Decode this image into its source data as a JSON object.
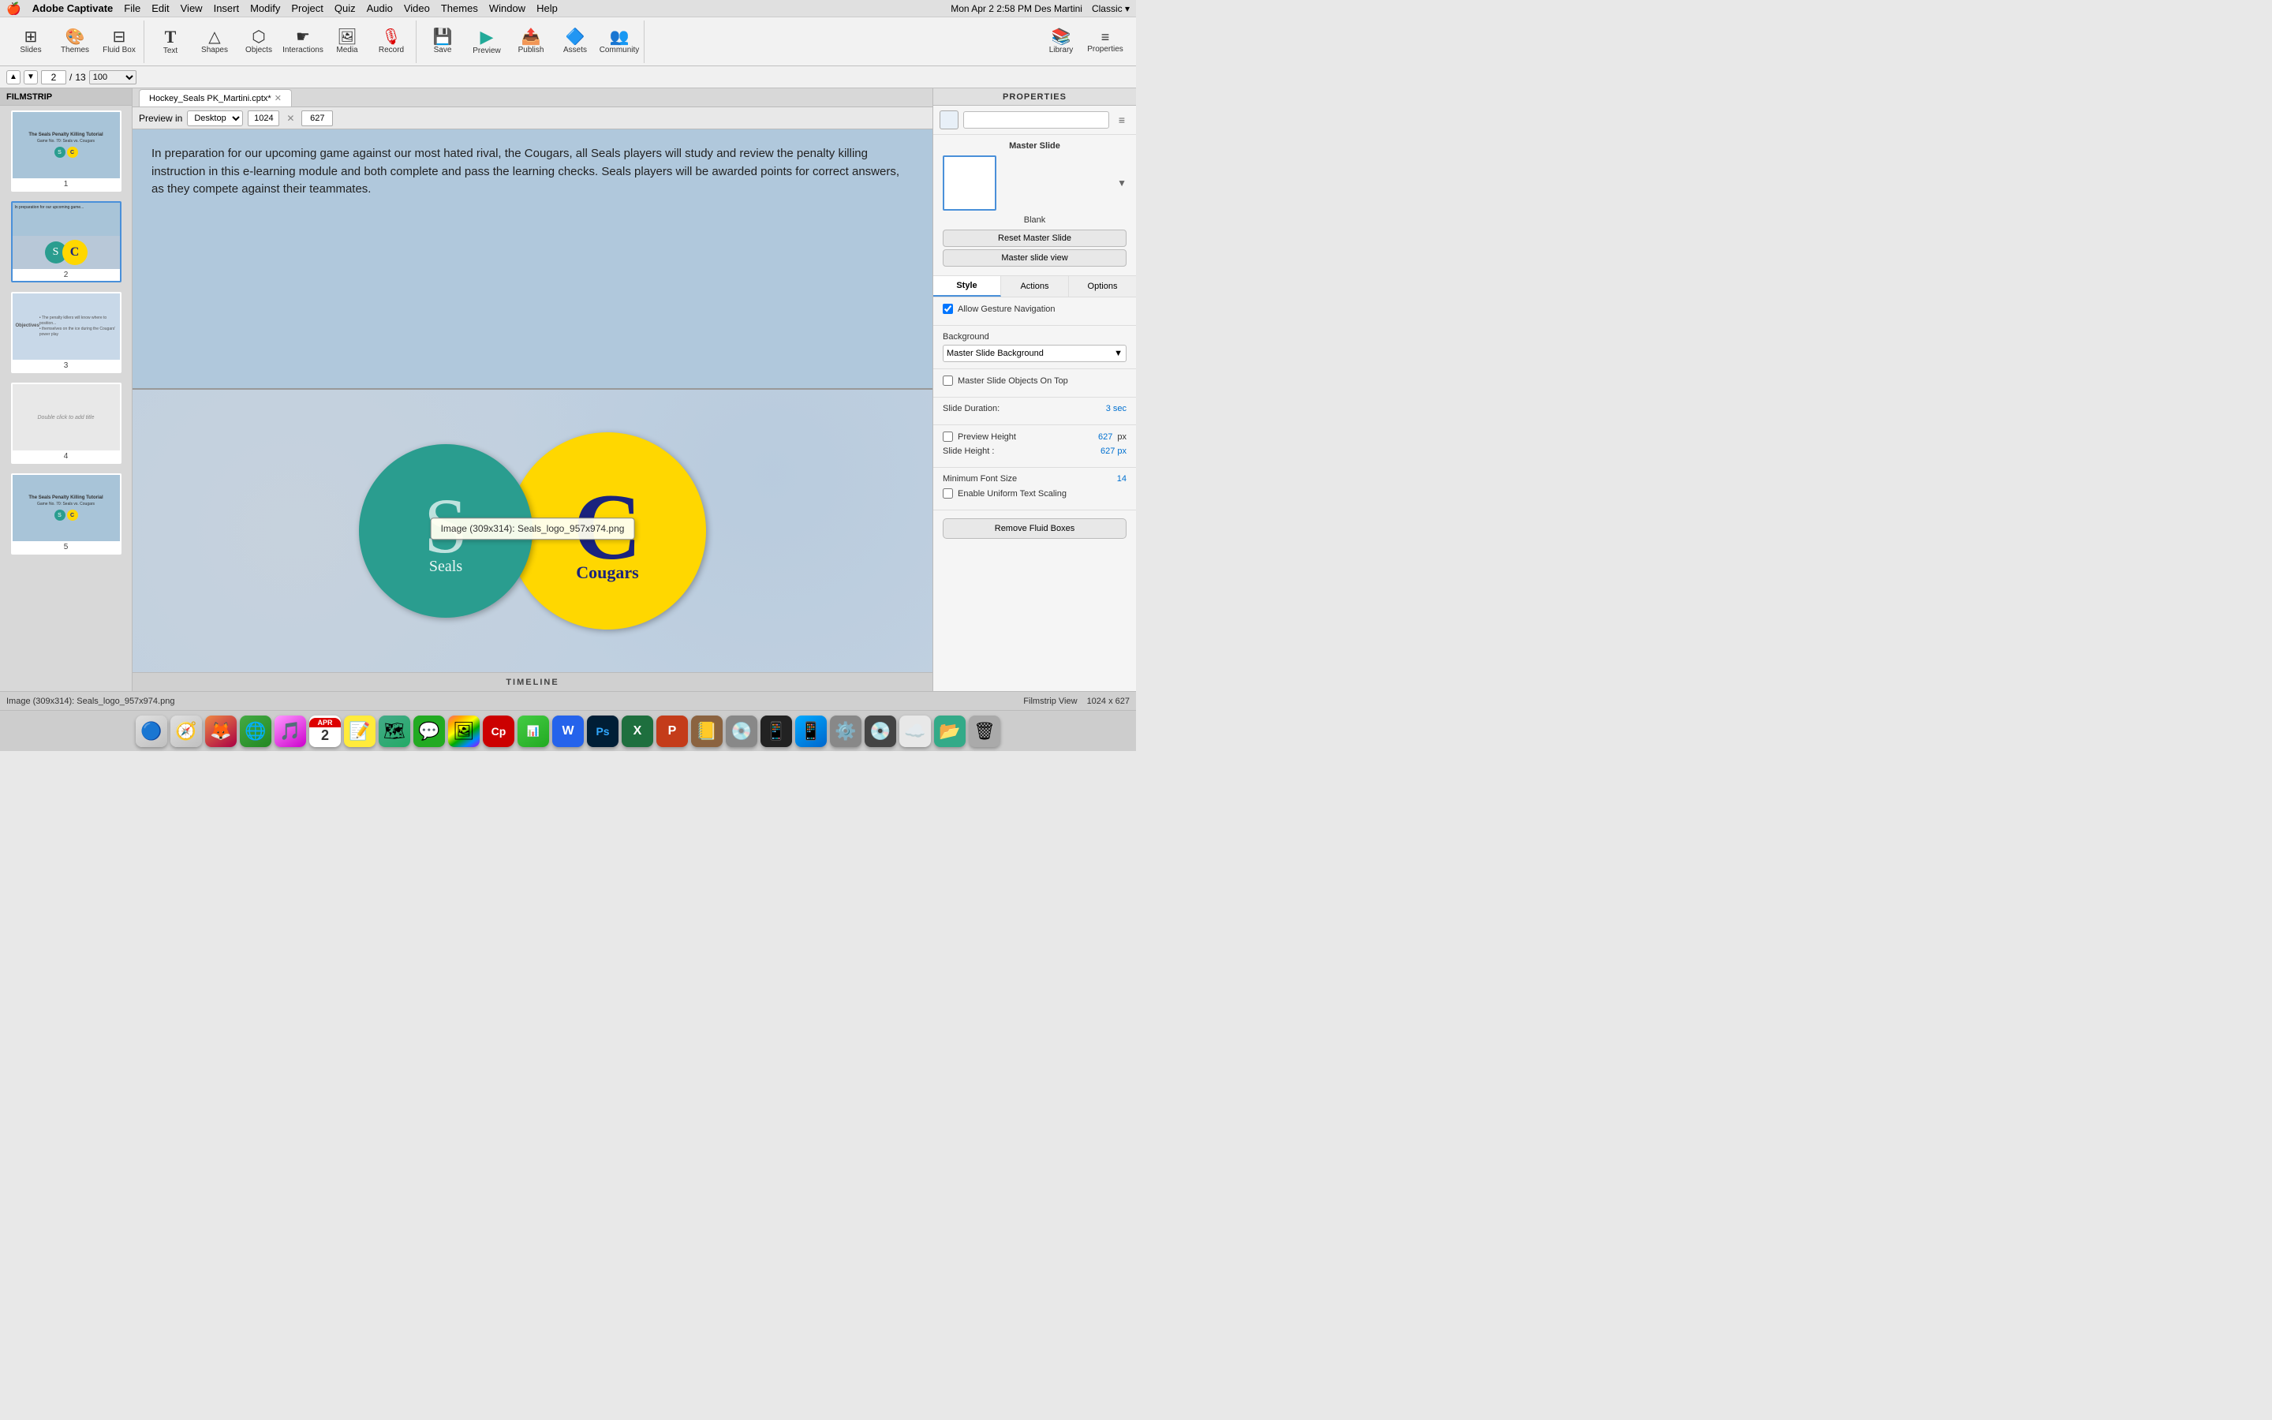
{
  "menubar": {
    "apple": "🍎",
    "app_name": "Adobe Captivate",
    "menus": [
      "File",
      "Edit",
      "View",
      "Insert",
      "Modify",
      "Project",
      "Quiz",
      "Audio",
      "Video",
      "Themes",
      "Window",
      "Help"
    ],
    "right_info": "Mon Apr 2  2:58 PM  Des Martini",
    "classic_label": "Classic ▾"
  },
  "toolbar": {
    "buttons": [
      {
        "id": "slides",
        "icon": "⊞",
        "label": "Slides"
      },
      {
        "id": "themes",
        "icon": "🎨",
        "label": "Themes"
      },
      {
        "id": "fluidbox",
        "icon": "⊟",
        "label": "Fluid Box"
      },
      {
        "id": "text",
        "icon": "T",
        "label": "Text"
      },
      {
        "id": "shapes",
        "icon": "△",
        "label": "Shapes"
      },
      {
        "id": "objects",
        "icon": "⬡",
        "label": "Objects"
      },
      {
        "id": "interactions",
        "icon": "☛",
        "label": "Interactions"
      },
      {
        "id": "media",
        "icon": "🖼",
        "label": "Media"
      },
      {
        "id": "record",
        "icon": "🎙",
        "label": "Record"
      },
      {
        "id": "save",
        "icon": "💾",
        "label": "Save"
      },
      {
        "id": "preview",
        "icon": "▷",
        "label": "Preview"
      },
      {
        "id": "publish",
        "icon": "📤",
        "label": "Publish"
      },
      {
        "id": "assets",
        "icon": "🔷",
        "label": "Assets"
      },
      {
        "id": "community",
        "icon": "👥",
        "label": "Community"
      }
    ],
    "right_buttons": [
      {
        "id": "library",
        "icon": "📚",
        "label": "Library"
      },
      {
        "id": "properties",
        "icon": "≡",
        "label": "Properties"
      }
    ]
  },
  "nav_bar": {
    "current_page": "2",
    "total_pages": "13",
    "zoom": "100"
  },
  "filmstrip": {
    "header": "FILMSTRIP",
    "slides": [
      {
        "number": "1",
        "content": "title_slide"
      },
      {
        "number": "2",
        "content": "logo_slide",
        "active": true
      },
      {
        "number": "3",
        "content": "objectives_slide"
      },
      {
        "number": "4",
        "content": "blank_slide"
      },
      {
        "number": "5",
        "content": "title_slide2"
      }
    ]
  },
  "canvas": {
    "tab_name": "Hockey_Seals PK_Martini.cptx*",
    "preview_in": "Preview in",
    "preview_mode": "Desktop",
    "width": "1024",
    "height": "627",
    "slide_text": "In preparation for our upcoming game against our most hated rival, the Cougars, all Seals players will study  and review the penalty killing instruction in this e-learning module and both complete and pass the learning checks. Seals players will be awarded points for correct answers, as they compete against their teammates.",
    "tooltip": "Image (309x314): Seals_logo_957x974.png",
    "seals_letter": "S",
    "seals_label": "Seals",
    "cougars_letter": "C",
    "cougars_label": "Cougars",
    "timeline_label": "TIMELINE"
  },
  "properties": {
    "header": "PROPERTIES",
    "master_slide_label": "Master Slide",
    "blank_label": "Blank",
    "reset_btn": "Reset Master Slide",
    "master_view_btn": "Master slide view",
    "tabs": [
      "Style",
      "Actions",
      "Options"
    ],
    "active_tab": "Style",
    "allow_gesture": "Allow Gesture Navigation",
    "background_label": "Background",
    "background_value": "Master Slide Background",
    "master_objects_top": "Master Slide Objects On Top",
    "slide_duration_label": "Slide Duration:",
    "slide_duration_value": "3 sec",
    "preview_height_label": "Preview Height",
    "preview_height_value": "627",
    "preview_height_unit": "px",
    "slide_height_label": "Slide Height :",
    "slide_height_value": "627 px",
    "min_font_size_label": "Minimum Font Size",
    "min_font_size_value": "14",
    "uniform_text_label": "Enable Uniform Text Scaling",
    "remove_fluid_btn": "Remove Fluid Boxes",
    "actions_label": "Actions"
  },
  "status_bar": {
    "left": "Image (309x314): Seals_logo_957x974.png",
    "filmstrip_view": "Filmstrip View",
    "dimensions": "1024 x 627"
  },
  "dock": {
    "icons": [
      "🔵",
      "🦊",
      "🌐",
      "🎵",
      "📅",
      "📝",
      "🗺",
      "💬",
      "📷",
      "🎨",
      "📅",
      "📊",
      "W",
      "Ps",
      "X",
      "P",
      "📒",
      "💿",
      "📱",
      "🖼",
      "⚙️",
      "💿",
      "📱",
      "📂",
      "🗑"
    ]
  }
}
